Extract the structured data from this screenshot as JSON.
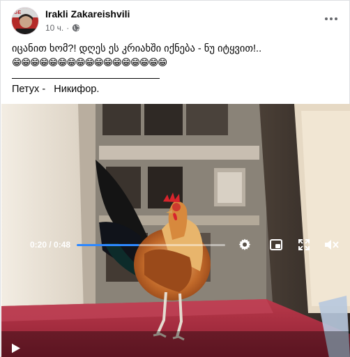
{
  "post": {
    "author": "Irakli Zakareishvili",
    "time": "10 ч.",
    "dot": "·",
    "audience_icon": "globe-icon",
    "more_icon": "more-options-icon",
    "line1": "იცანით ხომ?! დღეს ეს კრიახში იქნება - ნუ იტყვით!..",
    "emojis": "😁😁😁😁😁😁😁😁😁😁😁😁😁😁😁😁😁",
    "underline": "_______________________________",
    "caption": "Петух -   Никифор."
  },
  "video": {
    "current_time": "0:20",
    "separator": " / ",
    "duration": "0:48",
    "progress_fraction": 0.417,
    "icons": [
      "play-icon",
      "settings-icon",
      "picture-in-picture-icon",
      "fullscreen-icon",
      "volume-icon"
    ],
    "accent": "#2d88ff"
  }
}
